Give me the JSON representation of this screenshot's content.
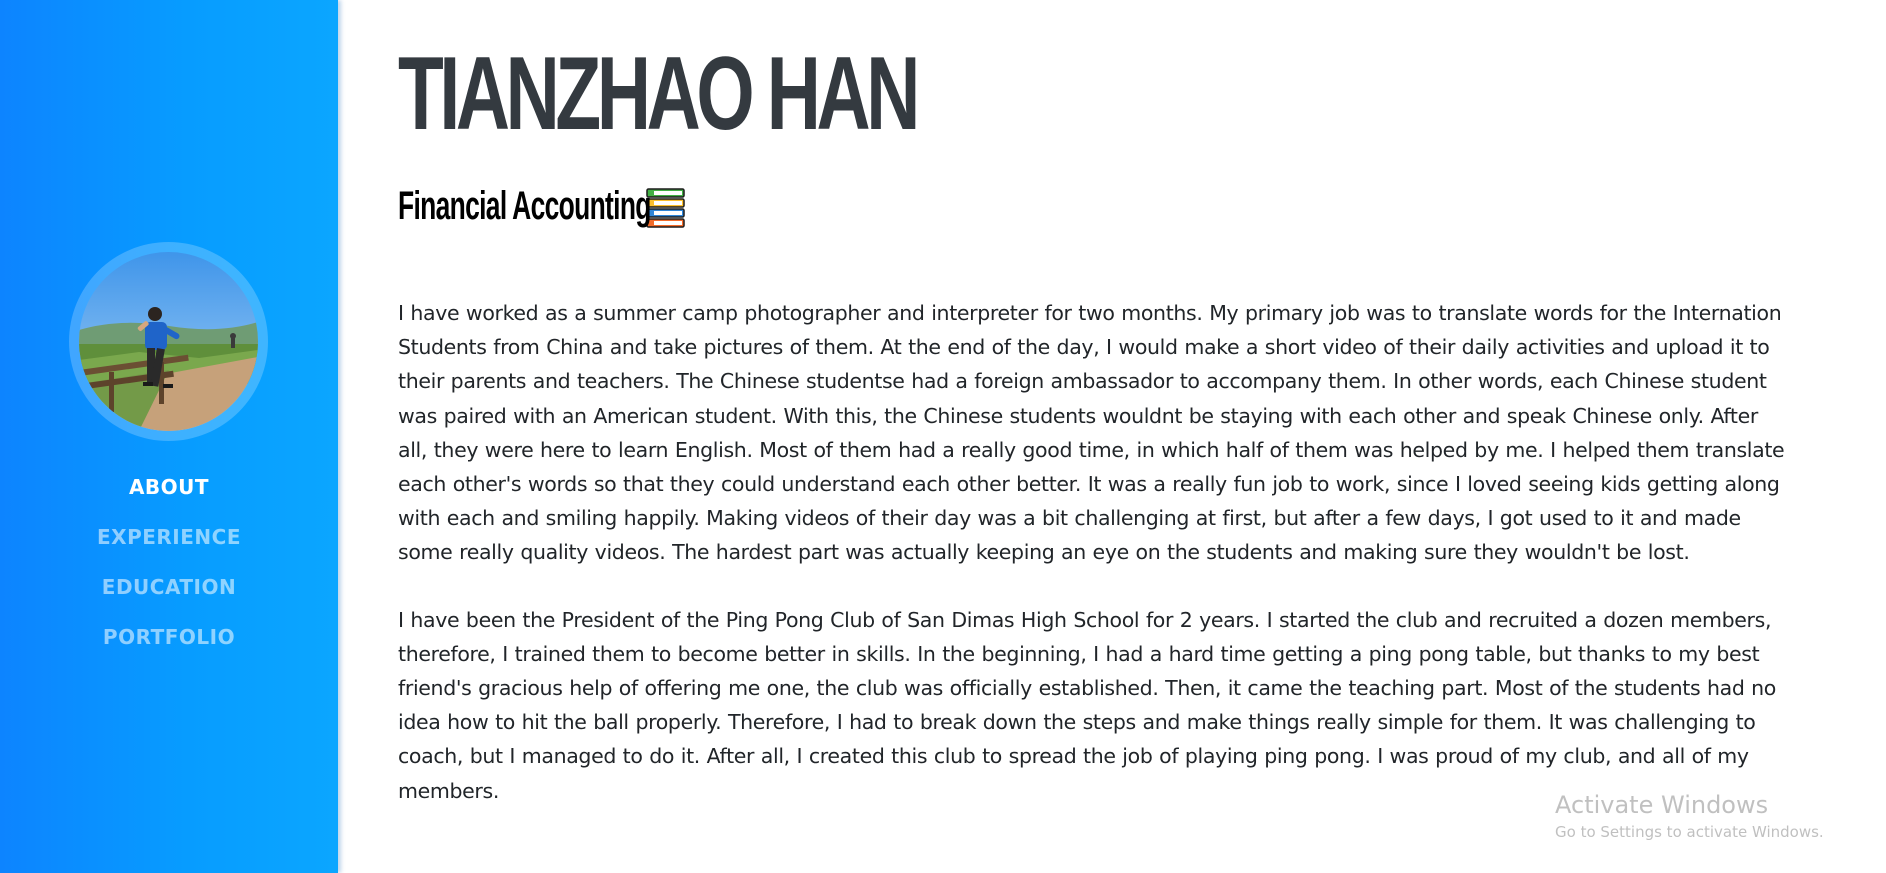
{
  "profile": {
    "name": "TIANZHAO HAN",
    "subtitle": "Financial Accounting",
    "subtitle_icon": "books-icon"
  },
  "nav": {
    "items": [
      {
        "label": "ABOUT",
        "active": true
      },
      {
        "label": "EXPERIENCE",
        "active": false
      },
      {
        "label": "EDUCATION",
        "active": false
      },
      {
        "label": "PORTFOLIO",
        "active": false
      }
    ]
  },
  "about": {
    "paragraphs": [
      "I have worked as a summer camp photographer and interpreter for two months. My primary job was to translate words for the Internation Students from China and take pictures of them. At the end of the day, I would make a short video of their daily activities and upload it to their parents and teachers. The Chinese studentse had a foreign ambassador to accompany them. In other words, each Chinese student was paired with an American student. With this, the Chinese students wouldnt be staying with each other and speak Chinese only. After all, they were here to learn English. Most of them had a really good time, in which half of them was helped by me. I helped them translate each other's words so that they could understand each other better. It was a really fun job to work, since I loved seeing kids getting along with each and smiling happily. Making videos of their day was a bit challenging at first, but after a few days, I got used to it and made some really quality videos. The hardest part was actually keeping an eye on the students and making sure they wouldn't be lost.",
      "I have been the President of the Ping Pong Club of San Dimas High School for 2 years. I started the club and recruited a dozen members, therefore, I trained them to become better in skills. In the beginning, I had a hard time getting a ping pong table, but thanks to my best friend's gracious help of offering me one, the club was officially established. Then, it came the teaching part. Most of the students had no idea how to hit the ball properly. Therefore, I had to break down the steps and make things really simple for them. It was challenging to coach, but I managed to do it. After all, I created this club to spread the job of playing ping pong. I was proud of my club, and all of my members."
    ]
  },
  "watermark": {
    "title": "Activate Windows",
    "subtitle": "Go to Settings to activate Windows."
  },
  "colors": {
    "sidebar_start": "#0d84ff",
    "sidebar_end": "#0ba6ff",
    "heading": "#343a40",
    "text": "#212529",
    "nav_inactive": "rgba(255,255,255,0.55)",
    "nav_active": "#ffffff"
  }
}
